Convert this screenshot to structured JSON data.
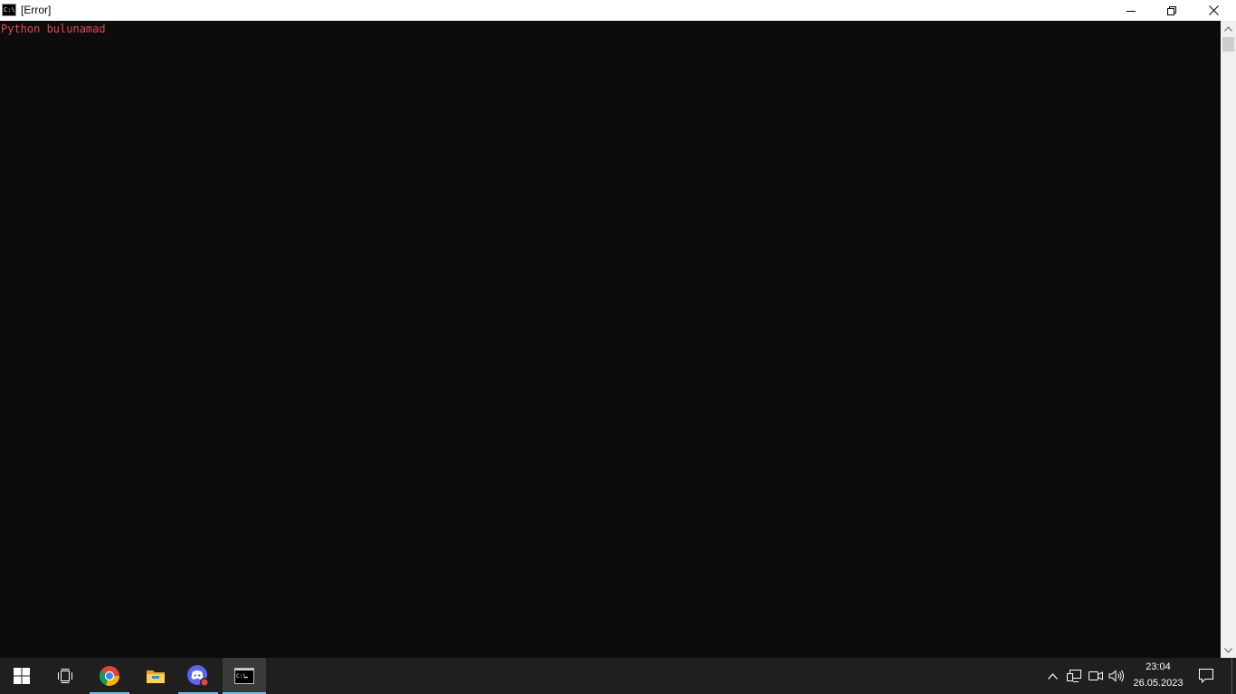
{
  "window": {
    "title": "[Error]",
    "icon": "cmd-icon",
    "controls": {
      "minimize": "minimize-icon",
      "maximize": "restore-icon",
      "close": "close-icon"
    }
  },
  "console": {
    "lines": [
      "Python bulunamad"
    ],
    "text_color": "#e74856",
    "background": "#0c0c0c"
  },
  "taskbar": {
    "apps": [
      {
        "name": "start",
        "icon": "windows-logo-icon"
      },
      {
        "name": "task-view",
        "icon": "task-view-icon"
      },
      {
        "name": "chrome",
        "icon": "chrome-icon",
        "open": true
      },
      {
        "name": "file-explorer",
        "icon": "folder-icon"
      },
      {
        "name": "discord",
        "icon": "discord-icon",
        "open": true
      },
      {
        "name": "command-prompt",
        "icon": "cmd-icon",
        "open": true,
        "active": true
      }
    ],
    "tray": {
      "icons": [
        "chevron-up-icon",
        "network-icon",
        "meet-now-icon",
        "volume-icon"
      ],
      "time": "23:04",
      "date": "26.05.2023",
      "notification_icon": "action-center-icon"
    },
    "accent": "#76b9ed"
  }
}
